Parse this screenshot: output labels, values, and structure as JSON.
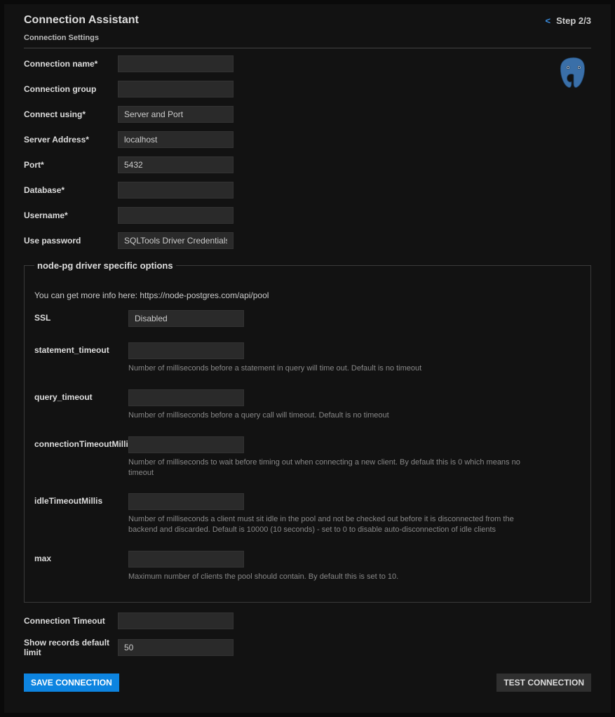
{
  "header": {
    "title": "Connection Assistant",
    "back_arrow": "<",
    "step_label": "Step 2/3"
  },
  "subheader": "Connection Settings",
  "fields": {
    "connection_name": {
      "label": "Connection name*",
      "value": ""
    },
    "connection_group": {
      "label": "Connection group",
      "value": ""
    },
    "connect_using": {
      "label": "Connect using*",
      "value": "Server and Port"
    },
    "server_address": {
      "label": "Server Address*",
      "value": "localhost"
    },
    "port": {
      "label": "Port*",
      "value": "5432"
    },
    "database": {
      "label": "Database*",
      "value": ""
    },
    "username": {
      "label": "Username*",
      "value": ""
    },
    "use_password": {
      "label": "Use password",
      "value": "SQLTools Driver Credentials"
    },
    "connection_timeout": {
      "label": "Connection Timeout",
      "value": ""
    },
    "show_records_limit": {
      "label": "Show records default limit",
      "value": "50"
    }
  },
  "driver_section": {
    "legend": "node-pg driver specific options",
    "info": "You can get more info here: https://node-postgres.com/api/pool",
    "ssl": {
      "label": "SSL",
      "value": "Disabled"
    },
    "statement_timeout": {
      "label": "statement_timeout",
      "value": "",
      "help": "Number of milliseconds before a statement in query will time out. Default is no timeout"
    },
    "query_timeout": {
      "label": "query_timeout",
      "value": "",
      "help": "Number of milliseconds before a query call will timeout. Default is no timeout"
    },
    "connectionTimeoutMillis": {
      "label": "connectionTimeoutMillis",
      "value": "",
      "help": "Number of milliseconds to wait before timing out when connecting a new client. By default this is 0 which means no timeout"
    },
    "idleTimeoutMillis": {
      "label": "idleTimeoutMillis",
      "value": "",
      "help": "Number of milliseconds a client must sit idle in the pool and not be checked out before it is disconnected from the backend and discarded. Default is 10000 (10 seconds) - set to 0 to disable auto-disconnection of idle clients"
    },
    "max": {
      "label": "max",
      "value": "",
      "help": "Maximum number of clients the pool should contain. By default this is set to 10."
    }
  },
  "buttons": {
    "save": "SAVE CONNECTION",
    "test": "TEST CONNECTION"
  }
}
